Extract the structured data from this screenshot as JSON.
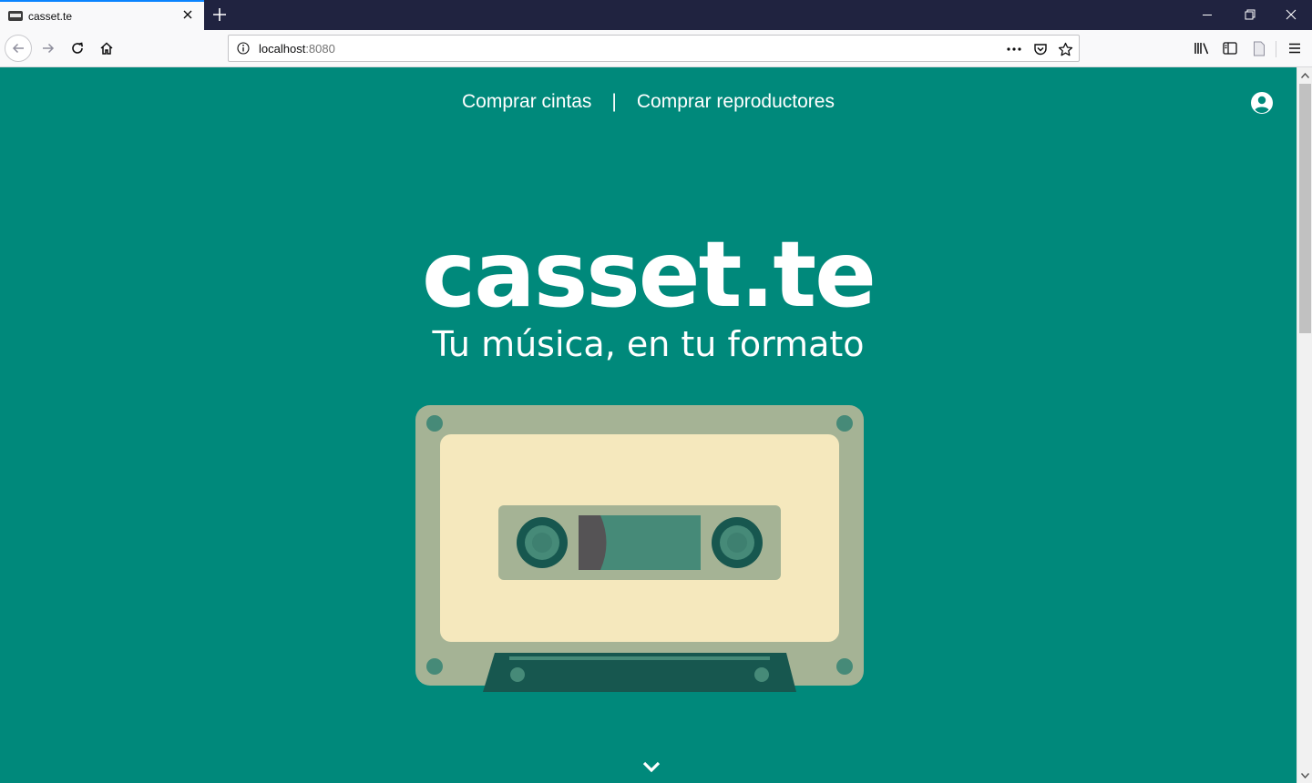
{
  "browser": {
    "tab": {
      "title": "casset.te"
    },
    "url": {
      "host": "localhost",
      "port": ":8080"
    }
  },
  "site": {
    "nav": {
      "link1": "Comprar cintas",
      "separator": "|",
      "link2": "Comprar reproductores"
    },
    "brand": "casset.te",
    "tagline": "Tu música, en tu formato"
  },
  "colors": {
    "page_bg": "#00897b",
    "cassette_shell": "#a5b395",
    "cassette_label": "#f5e8bd",
    "cassette_dark": "#17574f",
    "cassette_window": "#468a78"
  },
  "icons": {
    "user": "account-circle-icon",
    "scroll": "chevron-down-icon"
  }
}
